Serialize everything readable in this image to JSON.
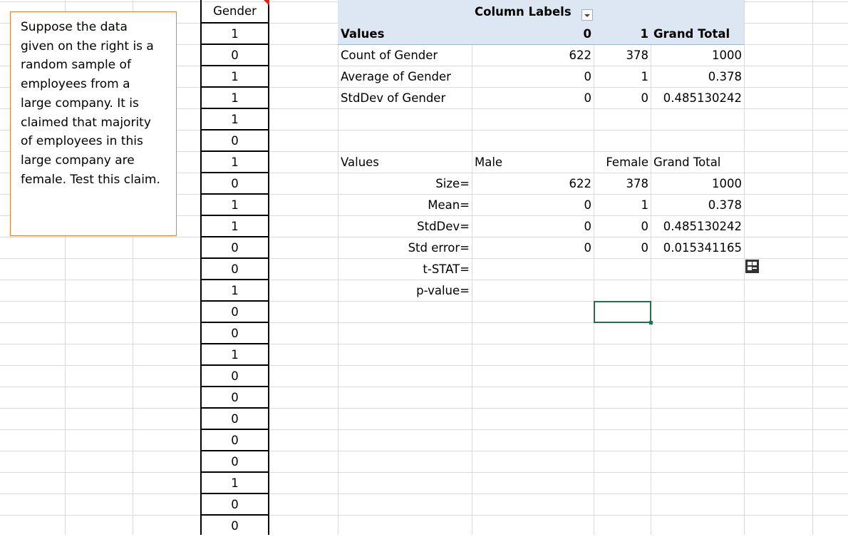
{
  "textbox": {
    "lines": [
      "Suppose the data",
      "given on the right is a",
      "random sample of",
      "employees from a",
      "large company. It is",
      "claimed that majority",
      "of employees in this",
      "large company are",
      "female. Test this claim."
    ]
  },
  "gender_column": {
    "header": "Gender",
    "values": [
      "1",
      "0",
      "1",
      "1",
      "1",
      "0",
      "1",
      "0",
      "1",
      "1",
      "0",
      "0",
      "1",
      "0",
      "0",
      "1",
      "0",
      "0",
      "0",
      "0",
      "0",
      "1",
      "0",
      "0"
    ]
  },
  "pivot": {
    "column_labels": "Column Labels",
    "header_values": "Values",
    "header_col0": "0",
    "header_col1": "1",
    "header_grand_total": "Grand Total",
    "rows": [
      {
        "label": "Count of Gender",
        "v0": "622",
        "v1": "378",
        "total": "1000"
      },
      {
        "label": "Average of Gender",
        "v0": "0",
        "v1": "1",
        "total": "0.378"
      },
      {
        "label": "StdDev of Gender",
        "v0": "0",
        "v1": "0",
        "total": "0.485130242"
      }
    ]
  },
  "summary": {
    "header_values": "Values",
    "header_male": "Male",
    "header_female": "Female",
    "header_grand_total": "Grand Total",
    "rows": [
      {
        "label": "Size=",
        "male": "622",
        "female": "378",
        "total": "1000"
      },
      {
        "label": "Mean=",
        "male": "0",
        "female": "1",
        "total": "0.378"
      },
      {
        "label": "StdDev=",
        "male": "0",
        "female": "0",
        "total": "0.485130242"
      },
      {
        "label": "Std error=",
        "male": "0",
        "female": "0",
        "total": "0.015341165"
      },
      {
        "label": "t-STAT=",
        "male": "",
        "female": "",
        "total": ""
      },
      {
        "label": "p-value=",
        "male": "",
        "female": "",
        "total": ""
      }
    ]
  },
  "colors": {
    "gridline": "#D9D9D9",
    "pivot_header": "#DDE6F3",
    "textbox_border": "#ED7D31",
    "selection": "#217346"
  },
  "icons": {
    "filter": "dropdown-filter-icon",
    "quick_analysis": "quick-analysis-icon"
  }
}
